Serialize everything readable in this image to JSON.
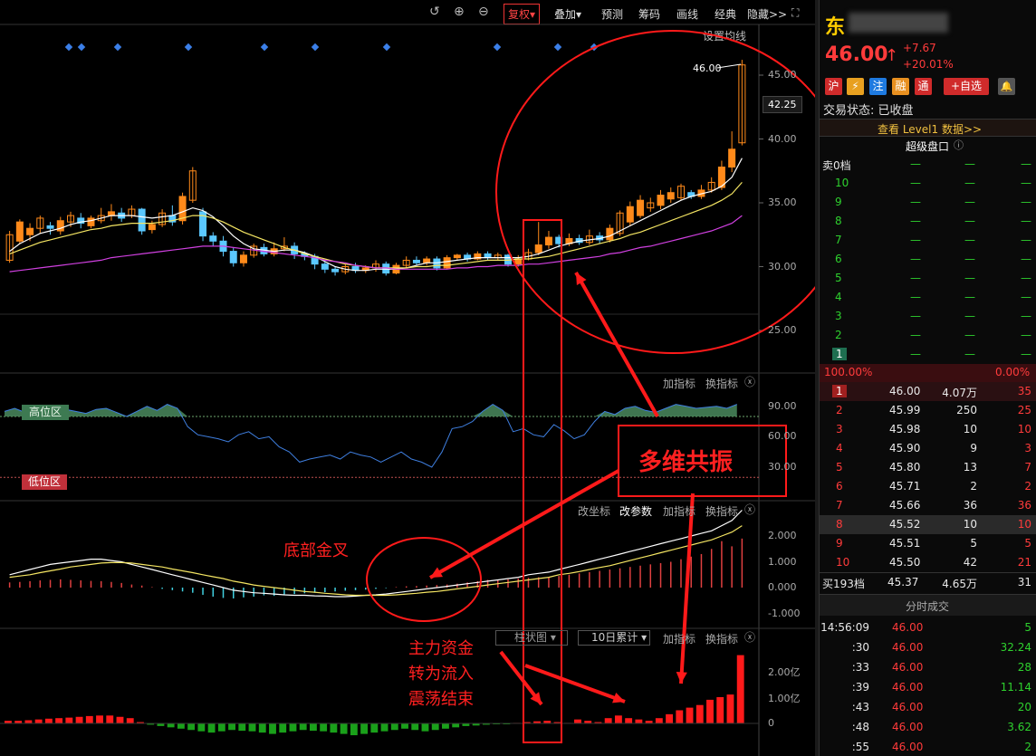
{
  "toolbar": {
    "fuquan": "复权▾",
    "diejia": "叠加▾",
    "yuce": "预测",
    "chouma": "筹码",
    "huaxian": "画线",
    "jingdian": "经典",
    "yincang": "隐藏>>",
    "set_ma": "设置均线"
  },
  "price_axis": {
    "ticks": [
      "45.00",
      "40.00",
      "35.00",
      "30.00",
      "25.00"
    ],
    "current": "42.25",
    "last_label": "46.00"
  },
  "indicator1": {
    "add": "加指标",
    "switch": "换指标",
    "ticks": [
      "90.00",
      "60.00",
      "30.00"
    ],
    "high_zone": "高位区",
    "low_zone": "低位区"
  },
  "indicator2": {
    "coord": "改坐标",
    "param": "改参数",
    "add": "加指标",
    "switch": "换指标",
    "ticks": [
      "2.000",
      "1.000",
      "0.000",
      "-1.000"
    ]
  },
  "indicator3": {
    "select1": "柱状图",
    "select2": "10日累计",
    "add": "加指标",
    "switch": "换指标",
    "ticks": [
      "2.00亿",
      "1.00亿",
      "0"
    ]
  },
  "annotations": {
    "resonance": "多维共振",
    "golden_cross": "底部金叉",
    "fund_line1": "主力资金",
    "fund_line2": "转为流入",
    "fund_line3": "震荡结束"
  },
  "side": {
    "name": "东",
    "price": "46.00",
    "arrow": "↑",
    "change": "+7.67",
    "pct": "+20.01%",
    "badges": [
      "沪",
      "⚡",
      "注",
      "融",
      "通"
    ],
    "add_fav": "+自选",
    "status": "交易状态: 已收盘",
    "level1": "查看 Level1 数据>>",
    "super_panel": "超级盘口",
    "sell_title": "卖0档",
    "sell_levels": [
      "10",
      "9",
      "8",
      "7",
      "6",
      "5",
      "4",
      "3",
      "2",
      "1"
    ],
    "dash": "—",
    "ratio_left": "100.00%",
    "ratio_right": "0.00%",
    "buy_rows": [
      [
        "1",
        "46.00",
        "4.07万",
        "35"
      ],
      [
        "2",
        "45.99",
        "250",
        "25"
      ],
      [
        "3",
        "45.98",
        "10",
        "10"
      ],
      [
        "4",
        "45.90",
        "9",
        "3"
      ],
      [
        "5",
        "45.80",
        "13",
        "7"
      ],
      [
        "6",
        "45.71",
        "2",
        "2"
      ],
      [
        "7",
        "45.66",
        "36",
        "36"
      ],
      [
        "8",
        "45.52",
        "10",
        "10"
      ],
      [
        "9",
        "45.51",
        "5",
        "5"
      ],
      [
        "10",
        "45.50",
        "42",
        "21"
      ]
    ],
    "buy_total": [
      "买193档",
      "45.37",
      "4.65万",
      "31"
    ],
    "ticks_title": "分时成交",
    "trades": [
      [
        "14:56:09",
        "46.00",
        "5"
      ],
      [
        ":30",
        "46.00",
        "32.24"
      ],
      [
        ":33",
        "46.00",
        "28"
      ],
      [
        ":39",
        "46.00",
        "11.14"
      ],
      [
        ":43",
        "46.00",
        "20"
      ],
      [
        ":48",
        "46.00",
        "3.62"
      ],
      [
        ":55",
        "46.00",
        "2"
      ]
    ]
  },
  "colors": {
    "up": "#ff3b3b",
    "down": "#5bc8ff",
    "annot": "#ff1a1a",
    "ma_white": "#ffffff",
    "ma_yellow": "#f5e663",
    "ma_purple": "#d040e0"
  },
  "chart_data": {
    "type": "candlestick",
    "y_range": [
      22.5,
      47.5
    ],
    "candles": [
      [
        30.5,
        32.5,
        30.3,
        32.8,
        1
      ],
      [
        32.0,
        33.5,
        31.8,
        33.7,
        1
      ],
      [
        32.5,
        33.0,
        32.0,
        33.4,
        1
      ],
      [
        33.0,
        33.8,
        32.6,
        34.0,
        1
      ],
      [
        33.2,
        33.0,
        32.5,
        33.5,
        0
      ],
      [
        32.8,
        33.6,
        32.5,
        33.9,
        1
      ],
      [
        33.5,
        34.0,
        33.1,
        34.3,
        1
      ],
      [
        33.8,
        33.4,
        33.0,
        34.2,
        0
      ],
      [
        33.2,
        33.8,
        33.0,
        34.0,
        1
      ],
      [
        33.6,
        34.0,
        33.4,
        34.6,
        1
      ],
      [
        34.0,
        34.3,
        33.6,
        34.9,
        1
      ],
      [
        34.2,
        33.8,
        33.5,
        34.6,
        0
      ],
      [
        34.0,
        34.5,
        33.8,
        34.8,
        1
      ],
      [
        34.5,
        32.8,
        32.5,
        34.6,
        0
      ],
      [
        32.9,
        33.3,
        32.6,
        33.6,
        1
      ],
      [
        33.3,
        34.2,
        33.1,
        34.5,
        1
      ],
      [
        34.0,
        33.5,
        33.2,
        34.8,
        1
      ],
      [
        33.6,
        35.5,
        33.3,
        35.8,
        1
      ],
      [
        35.2,
        37.5,
        35.0,
        37.8,
        1
      ],
      [
        34.3,
        32.4,
        32.0,
        34.6,
        0
      ],
      [
        32.4,
        32.0,
        31.6,
        32.7,
        0
      ],
      [
        32.0,
        31.2,
        30.8,
        32.4,
        0
      ],
      [
        31.2,
        30.3,
        30.0,
        31.5,
        0
      ],
      [
        30.3,
        30.9,
        30.0,
        31.2,
        1
      ],
      [
        30.9,
        31.6,
        30.7,
        31.8,
        1
      ],
      [
        31.5,
        31.0,
        30.8,
        31.8,
        0
      ],
      [
        31.0,
        31.4,
        30.8,
        31.9,
        1
      ],
      [
        31.4,
        31.6,
        31.2,
        32.3,
        1
      ],
      [
        31.6,
        31.0,
        30.6,
        31.9,
        0
      ],
      [
        31.0,
        30.8,
        30.5,
        31.2,
        0
      ],
      [
        30.8,
        30.2,
        29.8,
        31.0,
        0
      ],
      [
        30.2,
        29.8,
        29.5,
        30.4,
        0
      ],
      [
        29.8,
        29.6,
        29.3,
        30.0,
        0
      ],
      [
        29.6,
        30.0,
        29.4,
        30.2,
        1
      ],
      [
        30.0,
        29.7,
        29.5,
        30.3,
        0
      ],
      [
        29.7,
        29.9,
        29.5,
        30.1,
        1
      ],
      [
        29.9,
        30.2,
        29.6,
        30.5,
        1
      ],
      [
        30.2,
        29.5,
        29.3,
        30.4,
        0
      ],
      [
        29.5,
        30.1,
        29.4,
        30.3,
        1
      ],
      [
        30.1,
        30.5,
        29.9,
        30.8,
        1
      ],
      [
        30.5,
        30.3,
        30.1,
        30.8,
        0
      ],
      [
        30.3,
        30.6,
        30.1,
        30.8,
        1
      ],
      [
        30.6,
        29.9,
        29.7,
        30.8,
        0
      ],
      [
        29.9,
        30.7,
        29.8,
        30.9,
        1
      ],
      [
        30.7,
        30.9,
        30.5,
        31.0,
        1
      ],
      [
        30.9,
        30.6,
        30.4,
        31.1,
        0
      ],
      [
        30.6,
        31.0,
        30.5,
        31.2,
        1
      ],
      [
        31.0,
        30.7,
        30.5,
        31.2,
        0
      ],
      [
        30.7,
        30.9,
        30.5,
        31.1,
        1
      ],
      [
        30.9,
        30.2,
        30.0,
        31.0,
        0
      ],
      [
        30.2,
        30.6,
        30.0,
        30.9,
        1
      ],
      [
        30.6,
        31.1,
        30.5,
        31.4,
        1
      ],
      [
        31.1,
        31.7,
        30.9,
        33.5,
        1
      ],
      [
        31.7,
        32.3,
        31.4,
        32.8,
        1
      ],
      [
        32.3,
        31.8,
        31.5,
        32.5,
        1
      ],
      [
        31.8,
        32.2,
        31.6,
        32.6,
        1
      ],
      [
        32.2,
        31.9,
        31.7,
        32.5,
        1
      ],
      [
        31.9,
        32.4,
        31.7,
        32.9,
        1
      ],
      [
        32.4,
        32.1,
        31.8,
        32.7,
        1
      ],
      [
        32.1,
        33.0,
        31.9,
        33.3,
        1
      ],
      [
        32.6,
        34.2,
        32.4,
        34.4,
        1
      ],
      [
        33.5,
        34.7,
        33.2,
        35.1,
        1
      ],
      [
        34.0,
        35.2,
        33.8,
        35.6,
        1
      ],
      [
        34.6,
        35.0,
        34.3,
        35.4,
        1
      ],
      [
        34.8,
        35.6,
        34.5,
        36.0,
        1
      ],
      [
        35.3,
        35.8,
        35.0,
        36.2,
        1
      ],
      [
        35.4,
        36.3,
        35.2,
        36.5,
        1
      ],
      [
        35.8,
        35.5,
        35.3,
        36.0,
        1
      ],
      [
        35.5,
        36.0,
        35.3,
        36.4,
        1
      ],
      [
        36.0,
        36.6,
        35.8,
        37.0,
        1
      ],
      [
        36.2,
        37.8,
        36.0,
        38.3,
        1
      ],
      [
        37.8,
        39.2,
        37.4,
        40.6,
        1
      ],
      [
        39.7,
        45.8,
        39.5,
        46.2,
        1
      ]
    ],
    "ma_white": [
      31.2,
      31.8,
      32.2,
      32.6,
      32.8,
      33.0,
      33.3,
      33.5,
      33.6,
      33.8,
      34.0,
      34.0,
      34.0,
      33.9,
      33.8,
      33.9,
      34.0,
      34.3,
      34.6,
      34.4,
      33.9,
      33.2,
      32.4,
      31.8,
      31.4,
      31.3,
      31.2,
      31.3,
      31.3,
      31.1,
      30.8,
      30.4,
      30.0,
      29.8,
      29.7,
      29.7,
      29.8,
      29.8,
      29.8,
      29.9,
      30.1,
      30.3,
      30.3,
      30.4,
      30.5,
      30.6,
      30.7,
      30.7,
      30.7,
      30.7,
      30.7,
      30.8,
      31.0,
      31.3,
      31.6,
      31.8,
      32.0,
      32.1,
      32.2,
      32.4,
      32.8,
      33.2,
      33.6,
      34.0,
      34.4,
      34.8,
      35.2,
      35.5,
      35.7,
      35.9,
      36.3,
      37.0,
      38.5
    ],
    "ma_yellow": [
      31.0,
      31.3,
      31.6,
      31.9,
      32.1,
      32.3,
      32.5,
      32.7,
      32.9,
      33.0,
      33.2,
      33.3,
      33.4,
      33.4,
      33.4,
      33.5,
      33.6,
      33.8,
      34.0,
      34.0,
      33.8,
      33.5,
      33.1,
      32.7,
      32.4,
      32.1,
      31.8,
      31.5,
      31.3,
      31.0,
      30.8,
      30.6,
      30.4,
      30.2,
      30.1,
      30.0,
      29.9,
      29.9,
      29.9,
      29.9,
      30.0,
      30.0,
      30.1,
      30.1,
      30.2,
      30.3,
      30.4,
      30.5,
      30.5,
      30.5,
      30.6,
      30.6,
      30.7,
      30.8,
      31.0,
      31.2,
      31.4,
      31.6,
      31.8,
      32.0,
      32.2,
      32.5,
      32.7,
      33.0,
      33.3,
      33.6,
      33.9,
      34.2,
      34.5,
      34.8,
      35.2,
      35.7,
      36.6
    ],
    "ma_purple": [
      29.6,
      29.7,
      29.8,
      29.9,
      30.0,
      30.1,
      30.2,
      30.3,
      30.4,
      30.5,
      30.7,
      30.8,
      30.9,
      31.0,
      31.1,
      31.2,
      31.3,
      31.4,
      31.5,
      31.6,
      31.6,
      31.6,
      31.5,
      31.4,
      31.3,
      31.2,
      31.1,
      31.0,
      30.9,
      30.8,
      30.7,
      30.5,
      30.4,
      30.3,
      30.1,
      30.0,
      29.9,
      29.9,
      29.8,
      29.8,
      29.8,
      29.8,
      29.8,
      29.8,
      29.9,
      29.9,
      30.0,
      30.0,
      30.1,
      30.1,
      30.1,
      30.2,
      30.2,
      30.3,
      30.4,
      30.5,
      30.6,
      30.7,
      30.8,
      31.0,
      31.1,
      31.3,
      31.5,
      31.6,
      31.8,
      32.0,
      32.2,
      32.4,
      32.6,
      32.8,
      33.1,
      33.4,
      34.0
    ],
    "indicator1": [
      85,
      88,
      84,
      86,
      90,
      82,
      87,
      85,
      83,
      87,
      88,
      84,
      80,
      85,
      90,
      86,
      92,
      88,
      70,
      62,
      60,
      58,
      55,
      62,
      65,
      58,
      60,
      50,
      45,
      35,
      38,
      40,
      42,
      38,
      45,
      42,
      40,
      35,
      40,
      45,
      38,
      35,
      30,
      45,
      68,
      70,
      75,
      85,
      92,
      86,
      65,
      68,
      62,
      60,
      72,
      66,
      58,
      62,
      75,
      85,
      82,
      88,
      90,
      86,
      84,
      88,
      92,
      90,
      88,
      89,
      90,
      88,
      92
    ],
    "macd_hist": [
      0.2,
      0.22,
      0.25,
      0.28,
      0.3,
      0.32,
      0.3,
      0.28,
      0.26,
      0.25,
      0.22,
      0.18,
      0.12,
      0.08,
      0.02,
      -0.05,
      -0.1,
      -0.15,
      -0.2,
      -0.28,
      -0.35,
      -0.4,
      -0.42,
      -0.38,
      -0.35,
      -0.3,
      -0.32,
      -0.28,
      -0.25,
      -0.22,
      -0.2,
      -0.18,
      -0.15,
      -0.12,
      -0.1,
      -0.08,
      -0.05,
      -0.02,
      0.02,
      0.05,
      0.06,
      0.08,
      0.1,
      0.12,
      0.15,
      0.2,
      0.25,
      0.3,
      0.3,
      0.32,
      0.35,
      0.38,
      0.4,
      0.42,
      0.45,
      0.5,
      0.55,
      0.6,
      0.65,
      0.7,
      0.75,
      0.8,
      0.85,
      0.9,
      0.95,
      1.0,
      1.1,
      1.2,
      1.3,
      1.5,
      1.8,
      1.6,
      1.9
    ],
    "macd_dif": [
      0.5,
      0.6,
      0.7,
      0.8,
      0.9,
      0.95,
      1.0,
      1.05,
      1.1,
      1.1,
      1.05,
      1.0,
      0.9,
      0.8,
      0.7,
      0.6,
      0.5,
      0.4,
      0.3,
      0.2,
      0.1,
      0.0,
      -0.1,
      -0.15,
      -0.2,
      -0.22,
      -0.25,
      -0.28,
      -0.3,
      -0.3,
      -0.32,
      -0.33,
      -0.35,
      -0.35,
      -0.33,
      -0.3,
      -0.28,
      -0.25,
      -0.2,
      -0.15,
      -0.1,
      -0.05,
      0.0,
      0.05,
      0.1,
      0.15,
      0.2,
      0.25,
      0.3,
      0.35,
      0.4,
      0.5,
      0.55,
      0.6,
      0.7,
      0.8,
      0.9,
      1.0,
      1.1,
      1.2,
      1.3,
      1.4,
      1.5,
      1.6,
      1.7,
      1.8,
      1.9,
      2.0,
      2.1,
      2.2,
      2.4,
      2.6,
      3.0
    ],
    "macd_dea": [
      0.4,
      0.45,
      0.5,
      0.58,
      0.65,
      0.72,
      0.8,
      0.85,
      0.9,
      0.95,
      0.97,
      0.97,
      0.95,
      0.9,
      0.85,
      0.8,
      0.72,
      0.65,
      0.58,
      0.5,
      0.42,
      0.35,
      0.25,
      0.18,
      0.1,
      0.05,
      0.0,
      -0.05,
      -0.1,
      -0.15,
      -0.18,
      -0.22,
      -0.25,
      -0.28,
      -0.3,
      -0.3,
      -0.3,
      -0.3,
      -0.28,
      -0.25,
      -0.22,
      -0.18,
      -0.15,
      -0.1,
      -0.05,
      0.0,
      0.05,
      0.1,
      0.15,
      0.2,
      0.25,
      0.3,
      0.35,
      0.4,
      0.5,
      0.55,
      0.62,
      0.7,
      0.78,
      0.85,
      0.95,
      1.05,
      1.15,
      1.25,
      1.35,
      1.45,
      1.55,
      1.65,
      1.75,
      1.85,
      2.0,
      2.15,
      2.4
    ],
    "fund_flow": [
      0.1,
      0.1,
      0.12,
      0.15,
      0.18,
      0.2,
      0.22,
      0.25,
      0.28,
      0.3,
      0.3,
      0.25,
      0.2,
      0.05,
      -0.05,
      -0.1,
      -0.15,
      -0.2,
      -0.25,
      -0.3,
      -0.35,
      -0.3,
      -0.25,
      -0.28,
      -0.3,
      -0.35,
      -0.4,
      -0.35,
      -0.3,
      -0.25,
      -0.28,
      -0.3,
      -0.35,
      -0.4,
      -0.45,
      -0.4,
      -0.35,
      -0.3,
      -0.25,
      -0.2,
      -0.25,
      -0.3,
      -0.25,
      -0.2,
      -0.15,
      -0.1,
      -0.08,
      -0.05,
      -0.03,
      -0.02,
      0.02,
      0.05,
      0.08,
      0.1,
      0.05,
      0.02,
      0.15,
      0.1,
      0.05,
      0.2,
      0.3,
      0.2,
      0.15,
      0.1,
      0.2,
      0.35,
      0.5,
      0.6,
      0.7,
      0.9,
      1.0,
      1.1,
      2.6
    ]
  }
}
